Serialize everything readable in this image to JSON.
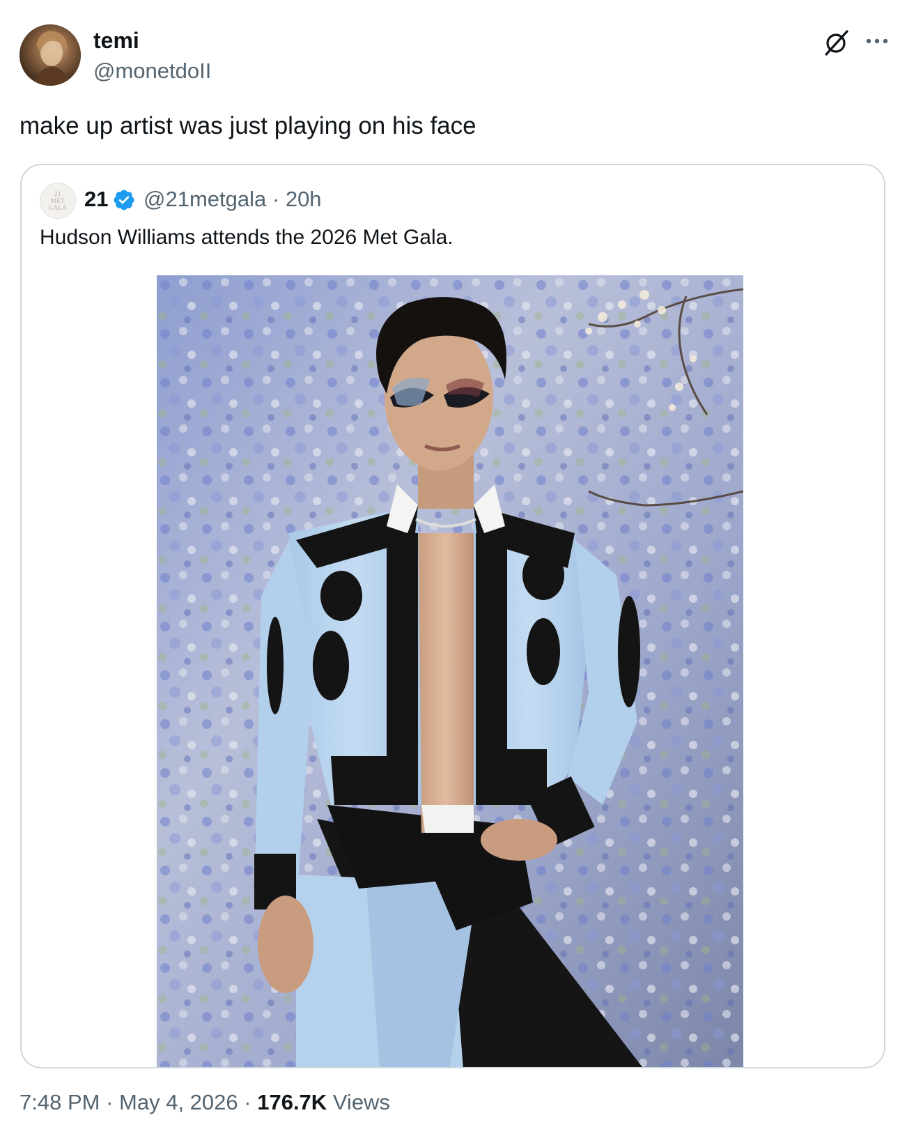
{
  "tweet": {
    "author": {
      "display_name": "temi",
      "handle": "@monetdoII",
      "avatar_icon": "profile-photo"
    },
    "text": "make up artist was just playing on his face",
    "header_actions": {
      "grok_icon": "grok-icon",
      "more_icon": "more-icon"
    }
  },
  "quoted_tweet": {
    "author": {
      "display_name": "21",
      "handle": "@21metgala",
      "avatar_text_line1": "21",
      "avatar_text_line2": "MET",
      "avatar_text_line3": "GALA",
      "verified": true,
      "verified_color": "#1d9bf0"
    },
    "separator": "·",
    "time_ago": "20h",
    "text": "Hudson Williams attends the 2026 Met Gala.",
    "media_icon": "photo-image"
  },
  "footer": {
    "time": "7:48 PM",
    "separator": "·",
    "date": "May 4, 2026",
    "separator2": "·",
    "views_count": "176.7K",
    "views_label": "Views"
  },
  "colors": {
    "text_primary": "#0f1419",
    "text_secondary": "#536471",
    "border": "#cfd9de",
    "verified_blue": "#1d9bf0"
  }
}
